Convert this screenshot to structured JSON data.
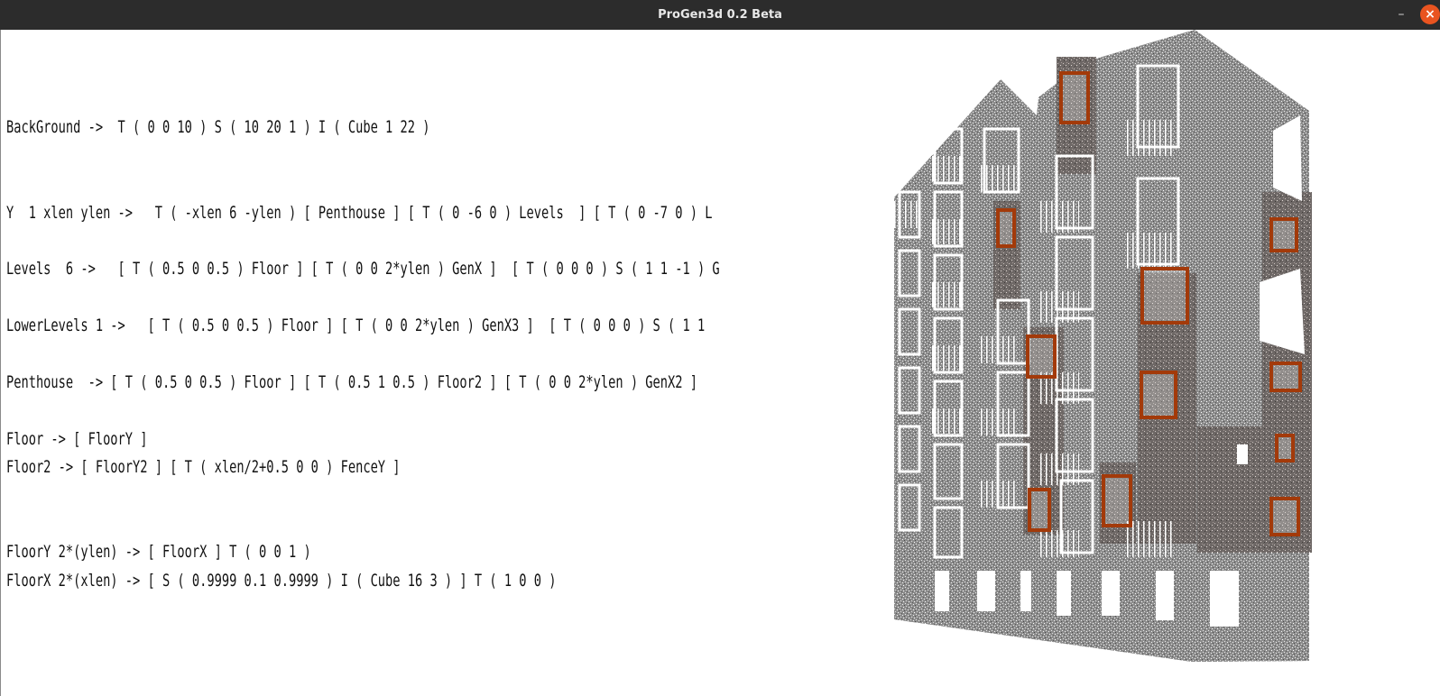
{
  "window": {
    "title": "ProGen3d 0.2 Beta",
    "minimize_glyph": "–",
    "close_glyph": "×"
  },
  "grammar_lines": [
    "BackGround ->  T ( 0 0 10 ) S ( 10 20 1 ) I ( Cube 1 22 )",
    "Y  1 xlen ylen ->   T ( -xlen 6 -ylen ) [ Penthouse ] [ T ( 0 -6 0 ) Levels  ] [ T ( 0 -7 0 ) L",
    "Levels  6 ->   [ T ( 0.5 0 0.5 ) Floor ] [ T ( 0 0 2*ylen ) GenX ]  [ T ( 0 0 0 ) S ( 1 1 -1 ) G",
    "LowerLevels 1 ->   [ T ( 0.5 0 0.5 ) Floor ] [ T ( 0 0 2*ylen ) GenX3 ]  [ T ( 0 0 0 ) S ( 1 1",
    "Penthouse  -> [ T ( 0.5 0 0.5 ) Floor ] [ T ( 0.5 1 0.5 ) Floor2 ] [ T ( 0 0 2*ylen ) GenX2 ]",
    "Floor -> [ FloorY ]",
    "Floor2 -> [ FloorY2 ] [ T ( xlen/2+0.5 0 0 ) FenceY ]",
    "FloorY 2*(ylen) -> [ FloorX ] T ( 0 0 1 )",
    "FloorX 2*(xlen) -> [ S ( 0.9999 0.1 0.9999 ) I ( Cube 16 3 ) ] T ( 1 0 0 )"
  ],
  "colors": {
    "titlebar": "#2c2c2c",
    "close_button": "#e95420",
    "wall": "#8e8e8e",
    "wall_dark": "#6f6a68",
    "window_frame_accent": "#a33a0a"
  }
}
